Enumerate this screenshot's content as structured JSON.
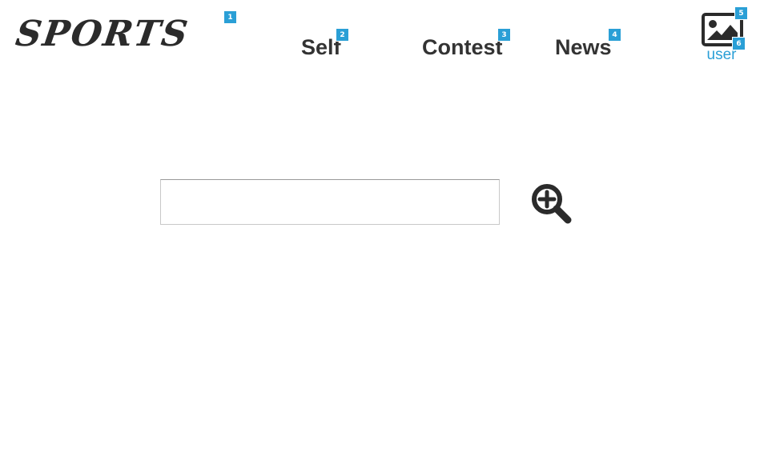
{
  "header": {
    "logo_text": "SPORTS",
    "nav": [
      {
        "label": "Self",
        "badge": "2"
      },
      {
        "label": "Contest",
        "badge": "3"
      },
      {
        "label": "News",
        "badge": "4"
      }
    ],
    "logo_badge": "1",
    "user": {
      "label": "user",
      "icon": "image-icon",
      "image_badge": "5",
      "label_badge": "6"
    }
  },
  "search": {
    "value": "",
    "placeholder": "",
    "button_icon": "zoom-in-icon"
  },
  "colors": {
    "badge": "#2a9fd6",
    "text": "#333333",
    "link": "#2a9fd6"
  }
}
